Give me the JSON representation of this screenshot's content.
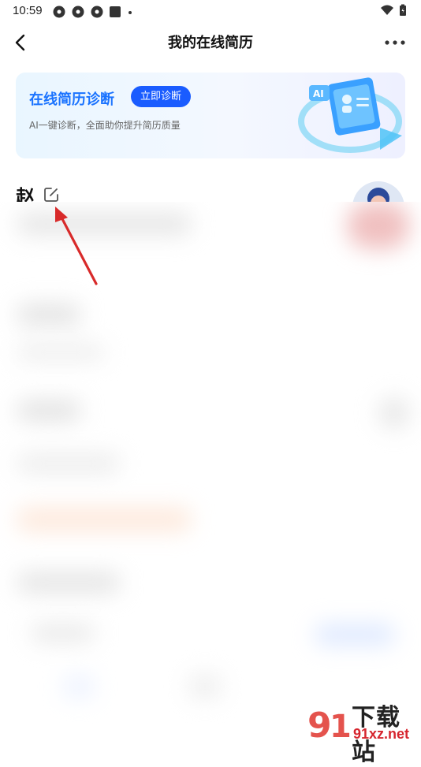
{
  "status_bar": {
    "time": "10:59"
  },
  "nav": {
    "title": "我的在线简历"
  },
  "banner": {
    "title": "在线简历诊断",
    "button_label": "立即诊断",
    "subtitle": "AI一键诊断，全面助你提升简历质量",
    "art_label": "AI"
  },
  "profile": {
    "name": "赵"
  },
  "watermark": {
    "text_cn": "下载站",
    "text_en": "91xz.net"
  },
  "colors": {
    "accent": "#1a5cff",
    "banner_title": "#1a73ff",
    "arrow": "#d82a2a"
  }
}
